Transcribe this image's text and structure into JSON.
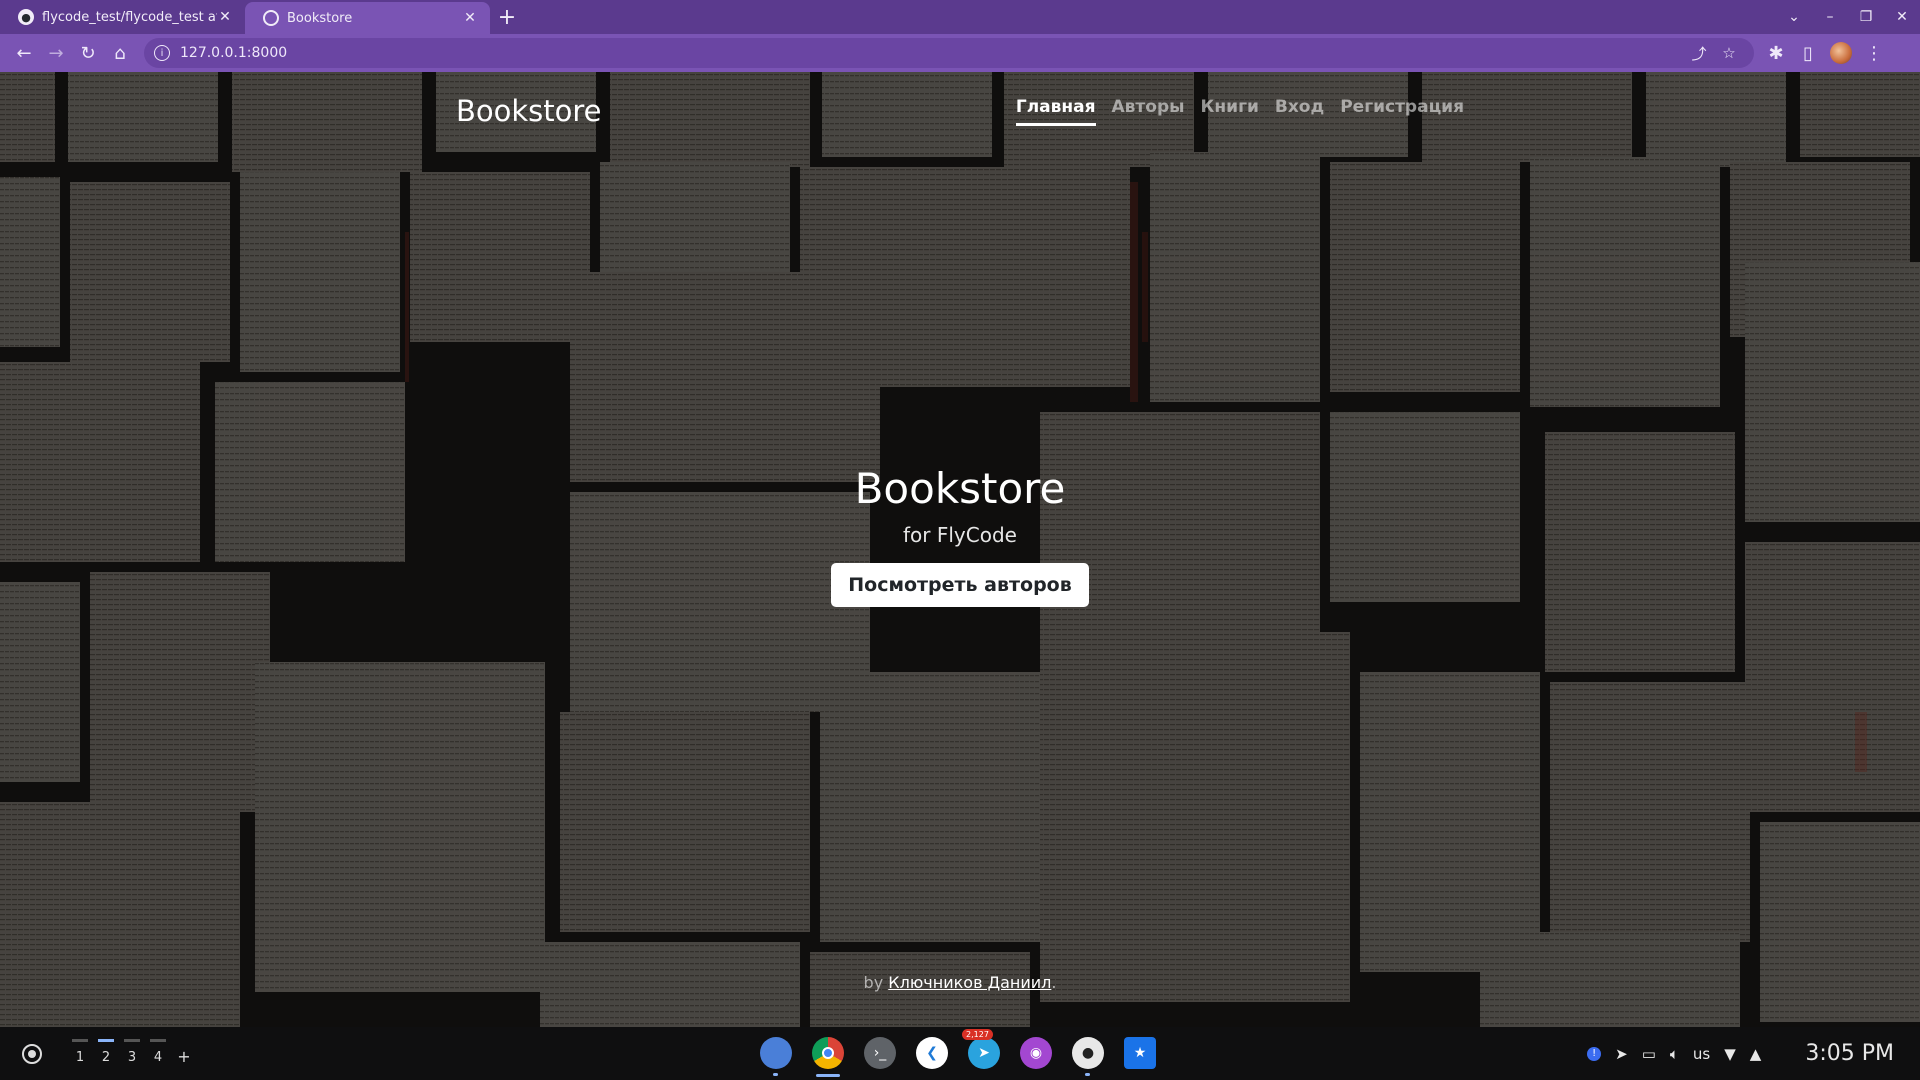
{
  "browser": {
    "tabs": [
      {
        "title": "flycode_test/flycode_test at",
        "icon": "github-icon",
        "active": false
      },
      {
        "title": "Bookstore",
        "icon": "globe-icon",
        "active": true
      }
    ],
    "address": "127.0.0.1:8000",
    "theme_color": "#7a54b4"
  },
  "site": {
    "brand": "Bookstore",
    "nav": [
      {
        "label": "Главная",
        "active": true
      },
      {
        "label": "Авторы",
        "active": false
      },
      {
        "label": "Книги",
        "active": false
      },
      {
        "label": "Вход",
        "active": false
      },
      {
        "label": "Регистрация",
        "active": false
      }
    ],
    "hero": {
      "title": "Bookstore",
      "subtitle": "for FlyCode",
      "cta": "Посмотреть авторов"
    },
    "footer": {
      "prefix": "by",
      "author": "Ключников Даниил",
      "suffix": "."
    }
  },
  "shelf": {
    "desks": [
      "1",
      "2",
      "3",
      "4"
    ],
    "add_desk": "+",
    "apps": [
      {
        "name": "files-icon"
      },
      {
        "name": "chrome-icon"
      },
      {
        "name": "terminal-icon"
      },
      {
        "name": "vscode-icon"
      },
      {
        "name": "telegram-icon",
        "badge": "2,127"
      },
      {
        "name": "podcast-icon"
      },
      {
        "name": "camera-icon"
      },
      {
        "name": "folder-icon"
      }
    ],
    "keyboard": "us",
    "clock": "3:05 PM"
  }
}
